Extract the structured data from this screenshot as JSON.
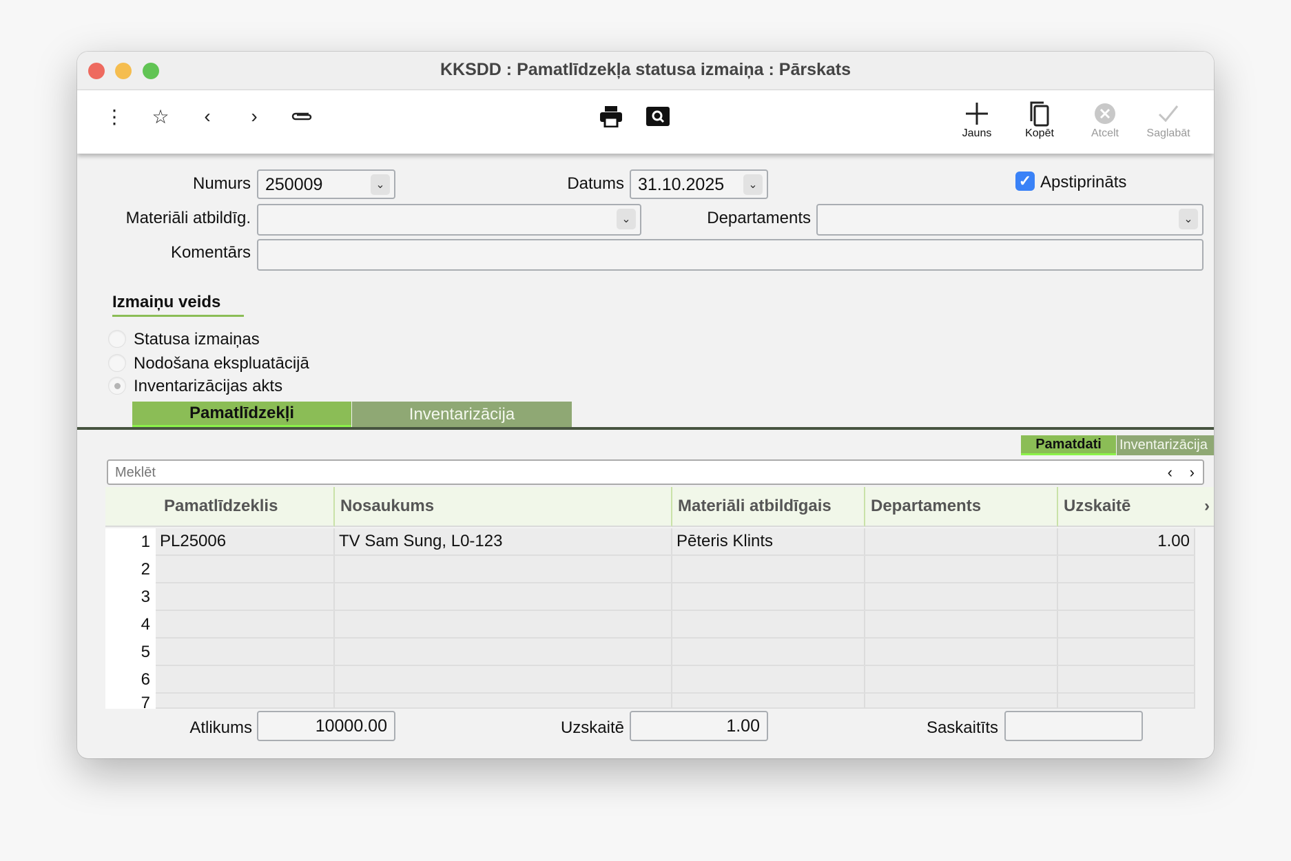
{
  "window": {
    "title": "KKSDD : Pamatlīdzekļa statusa izmaiņa : Pārskats",
    "traffic_lights": {
      "close": "#ee6a5f",
      "minimize": "#f5bd4f",
      "zoom": "#61c454"
    }
  },
  "toolbar": {
    "left_icons": [
      "more-vertical-icon",
      "star-icon",
      "chevron-left-icon",
      "chevron-right-icon",
      "paperclip-icon"
    ],
    "center_icons": [
      "printer-icon",
      "search-preview-icon"
    ],
    "buttons": [
      {
        "label": "Jauns",
        "icon": "plus-icon",
        "enabled": true
      },
      {
        "label": "Kopēt",
        "icon": "copy-icon",
        "enabled": true
      },
      {
        "label": "Atcelt",
        "icon": "cancel-icon",
        "enabled": false
      },
      {
        "label": "Saglabāt",
        "icon": "check-icon",
        "enabled": false
      }
    ]
  },
  "form": {
    "numurs": {
      "label": "Numurs",
      "value": "250009"
    },
    "datums": {
      "label": "Datums",
      "value": "31.10.2025"
    },
    "apstiprinats": {
      "label": "Apstiprināts",
      "checked": true
    },
    "materiali": {
      "label": "Materiāli atbildīg.",
      "value": ""
    },
    "departaments": {
      "label": "Departaments",
      "value": ""
    },
    "komentars": {
      "label": "Komentārs",
      "value": ""
    }
  },
  "change_type": {
    "title": "Izmaiņu veids",
    "options": [
      {
        "label": "Statusa izmaiņas",
        "selected": false
      },
      {
        "label": "Nodošana ekspluatācijā",
        "selected": false
      },
      {
        "label": "Inventarizācijas akts",
        "selected": true
      }
    ]
  },
  "tabs": [
    {
      "label": "Pamatlīdzekļi",
      "active": true
    },
    {
      "label": "Inventarizācija",
      "active": false
    }
  ],
  "subtabs": [
    {
      "label": "Pamatdati",
      "active": true
    },
    {
      "label": "Inventarizācija",
      "active": false
    }
  ],
  "search": {
    "placeholder": "Meklēt"
  },
  "table": {
    "columns": [
      "Pamatlīdzeklis",
      "Nosaukums",
      "Materiāli atbildīgais",
      "Departaments",
      "Uzskaitē"
    ],
    "rows": [
      {
        "n": "1",
        "cells": [
          "PL25006",
          "TV Sam Sung, L0-123",
          "Pēteris Klints",
          "",
          "1.00"
        ]
      },
      {
        "n": "2",
        "cells": [
          "",
          "",
          "",
          "",
          ""
        ]
      },
      {
        "n": "3",
        "cells": [
          "",
          "",
          "",
          "",
          ""
        ]
      },
      {
        "n": "4",
        "cells": [
          "",
          "",
          "",
          "",
          ""
        ]
      },
      {
        "n": "5",
        "cells": [
          "",
          "",
          "",
          "",
          ""
        ]
      },
      {
        "n": "6",
        "cells": [
          "",
          "",
          "",
          "",
          ""
        ]
      },
      {
        "n": "7",
        "cells": [
          "",
          "",
          "",
          "",
          ""
        ]
      }
    ]
  },
  "footer": {
    "atlikums": {
      "label": "Atlikums",
      "value": "10000.00"
    },
    "uzskaite": {
      "label": "Uzskaitē",
      "value": "1.00"
    },
    "saskaitits": {
      "label": "Saskaitīts",
      "value": ""
    }
  },
  "colors": {
    "accent_green": "#8bbd56",
    "tab_inactive": "#8fa874",
    "header_bg": "#f1f7e9",
    "checkbox_blue": "#3a82f7"
  }
}
